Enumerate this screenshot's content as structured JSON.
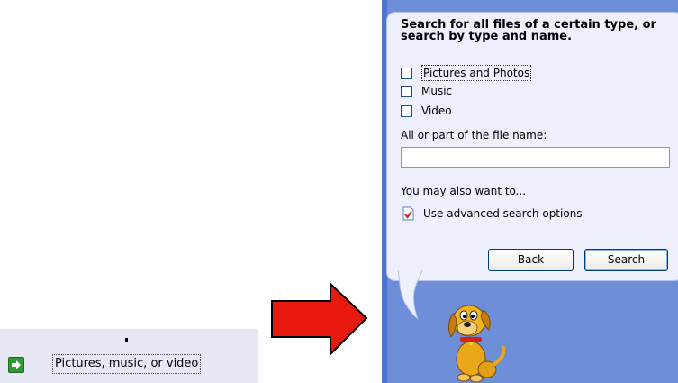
{
  "task_link": {
    "label": "Pictures, music, or video",
    "icon": "green-arrow-icon"
  },
  "transition_arrow": {
    "icon": "red-arrow-icon",
    "color": "#e8190f"
  },
  "search_pane": {
    "heading": "Search for all files of a certain type, or search by type and name.",
    "checkboxes": [
      {
        "label": "Pictures and Photos",
        "checked": false
      },
      {
        "label": "Music",
        "checked": false
      },
      {
        "label": "Video",
        "checked": false
      }
    ],
    "filename_label": "All or part of the file name:",
    "filename_value": "",
    "also_label": "You may also want to...",
    "advanced_link": "Use advanced search options",
    "back_button": "Back",
    "search_button": "Search",
    "companion": "search-dog-icon"
  },
  "colors": {
    "pane_background": "#6e8fd8",
    "balloon": "#eef0fd",
    "task_band": "#e8e8f4"
  }
}
